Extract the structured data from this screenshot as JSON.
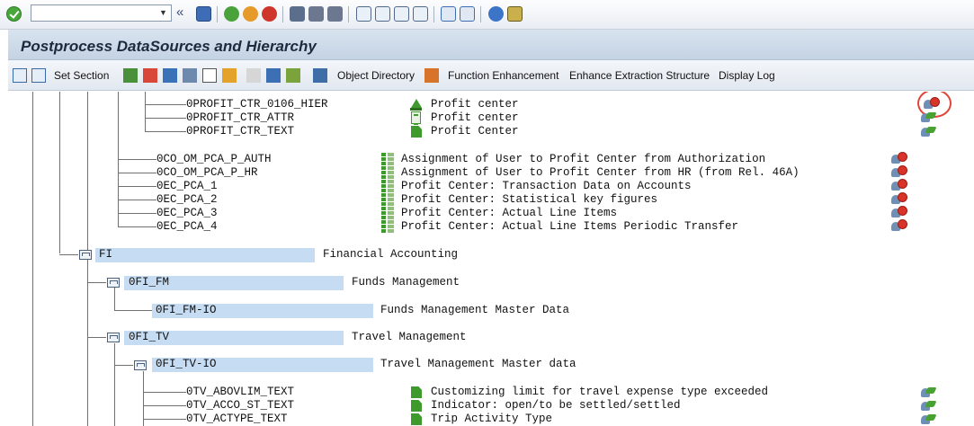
{
  "toolbar": {
    "command_value": ""
  },
  "title": "Postprocess DataSources and Hierarchy",
  "app_toolbar": {
    "set_section": "Set Section",
    "object_directory": "Object Directory",
    "function_enhancement": "Function Enhancement",
    "enhance_extraction_structure": "Enhance Extraction Structure",
    "display_log": "Display Log"
  },
  "tree": {
    "profit_center_sources": [
      {
        "tech": "0PROFIT_CTR_0106_HIER",
        "descr": "Profit center",
        "type": "hierarchy",
        "status": "inactive"
      },
      {
        "tech": "0PROFIT_CTR_ATTR",
        "descr": "Profit center",
        "type": "attributes",
        "status": "active"
      },
      {
        "tech": "0PROFIT_CTR_TEXT",
        "descr": "Profit Center",
        "type": "texts",
        "status": "active"
      }
    ],
    "transaction_sources": [
      {
        "tech": "0CO_OM_PCA_P_AUTH",
        "descr": "Assignment of User to Profit Center from Authorization",
        "status": "inactive"
      },
      {
        "tech": "0CO_OM_PCA_P_HR",
        "descr": "Assignment of User to Profit Center from HR (from Rel. 46A)",
        "status": "inactive"
      },
      {
        "tech": "0EC_PCA_1",
        "descr": "Profit Center: Transaction Data on Accounts",
        "status": "inactive"
      },
      {
        "tech": "0EC_PCA_2",
        "descr": "Profit Center: Statistical key figures",
        "status": "inactive"
      },
      {
        "tech": "0EC_PCA_3",
        "descr": "Profit Center: Actual Line Items",
        "status": "inactive"
      },
      {
        "tech": "0EC_PCA_4",
        "descr": "Profit Center: Actual Line Items Periodic Transfer",
        "status": "inactive"
      }
    ],
    "fi": {
      "tech": "FI",
      "descr": "Financial Accounting"
    },
    "fi_fm": {
      "tech": "0FI_FM",
      "descr": "Funds Management"
    },
    "fi_fm_io": {
      "tech": "0FI_FM-IO",
      "descr": "Funds Management Master Data"
    },
    "fi_tv": {
      "tech": "0FI_TV",
      "descr": "Travel Management"
    },
    "fi_tv_io": {
      "tech": "0FI_TV-IO",
      "descr": "Travel Management Master data"
    },
    "travel_sources": [
      {
        "tech": "0TV_ABOVLIM_TEXT",
        "descr": "Customizing limit for travel expense type exceeded",
        "status": "active"
      },
      {
        "tech": "0TV_ACCO_ST_TEXT",
        "descr": "Indicator: open/to be settled/settled",
        "status": "active"
      },
      {
        "tech": "0TV_ACTYPE_TEXT",
        "descr": "Trip Activity Type",
        "status": "active"
      }
    ]
  },
  "colors": {
    "highlight_ring": "#e0453a",
    "node_bar": "#c6dcf2",
    "title_bg": "#cfdbe9"
  }
}
